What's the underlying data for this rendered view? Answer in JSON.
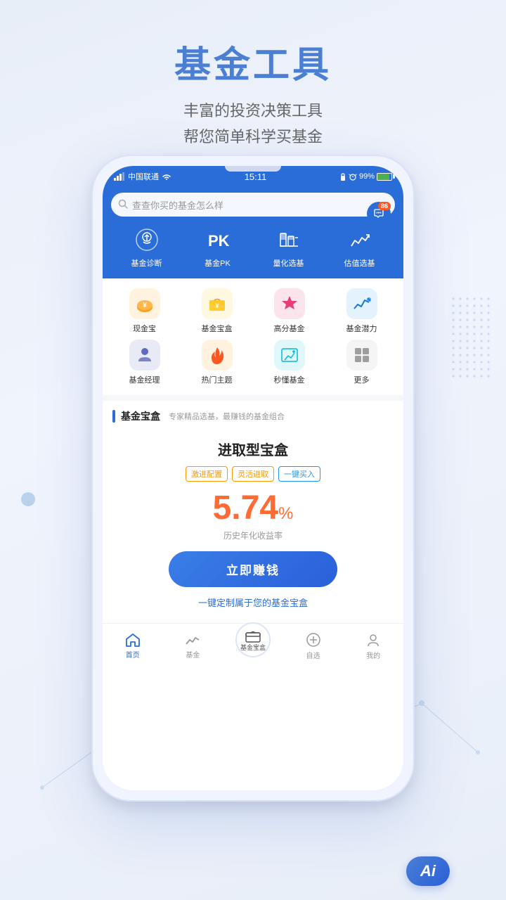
{
  "page": {
    "title": "基金工具",
    "subtitle_line1": "丰富的投资决策工具",
    "subtitle_line2": "帮您简单科学买基金"
  },
  "status_bar": {
    "carrier": "中国联通",
    "time": "15:11",
    "battery": "99%"
  },
  "search": {
    "placeholder": "查查你买的基金怎么样",
    "badge": "86"
  },
  "top_nav": {
    "items": [
      {
        "id": "fund-diagnosis",
        "label": "基金诊断"
      },
      {
        "id": "fund-pk",
        "label": "基金PK"
      },
      {
        "id": "quant-select",
        "label": "量化选基"
      },
      {
        "id": "value-select",
        "label": "估值选基"
      }
    ]
  },
  "grid_nav": {
    "row1": [
      {
        "id": "cash-treasure",
        "label": "现金宝",
        "color": "#fff3e0"
      },
      {
        "id": "fund-box",
        "label": "基金宝盒",
        "color": "#fff8e1"
      },
      {
        "id": "high-score",
        "label": "高分基金",
        "color": "#fce4ec"
      },
      {
        "id": "fund-potential",
        "label": "基金潜力",
        "color": "#e3f2fd"
      }
    ],
    "row2": [
      {
        "id": "fund-manager",
        "label": "基金经理",
        "color": "#e8eaf6"
      },
      {
        "id": "hot-theme",
        "label": "热门主题",
        "color": "#fff3e0"
      },
      {
        "id": "understand-fund",
        "label": "秒懂基金",
        "color": "#e0f7fa"
      },
      {
        "id": "more",
        "label": "更多",
        "color": "#f5f5f5"
      }
    ]
  },
  "section": {
    "bar_color": "#2a6dd9",
    "title": "基金宝盒",
    "description": "专家精品选基，最赚钱的基金组合"
  },
  "product": {
    "name": "进取型宝盒",
    "tags": [
      {
        "text": "激进配置",
        "style": "orange"
      },
      {
        "text": "灵活进取",
        "style": "orange"
      },
      {
        "text": "一键买入",
        "style": "blue"
      }
    ],
    "yield": "5.74",
    "yield_unit": "%",
    "yield_label": "历史年化收益率",
    "cta_label": "立即赚钱",
    "custom_link": "一键定制属于您的基金宝盒"
  },
  "tab_bar": {
    "items": [
      {
        "id": "home",
        "label": "首页",
        "active": true
      },
      {
        "id": "fund",
        "label": "基金",
        "active": false
      },
      {
        "id": "fund-box-center",
        "label": "基金宝盒",
        "active": false,
        "center": true
      },
      {
        "id": "self-select",
        "label": "自选",
        "active": false
      },
      {
        "id": "mine",
        "label": "我的",
        "active": false
      }
    ]
  },
  "bottom_ai": {
    "label": "Ai"
  }
}
